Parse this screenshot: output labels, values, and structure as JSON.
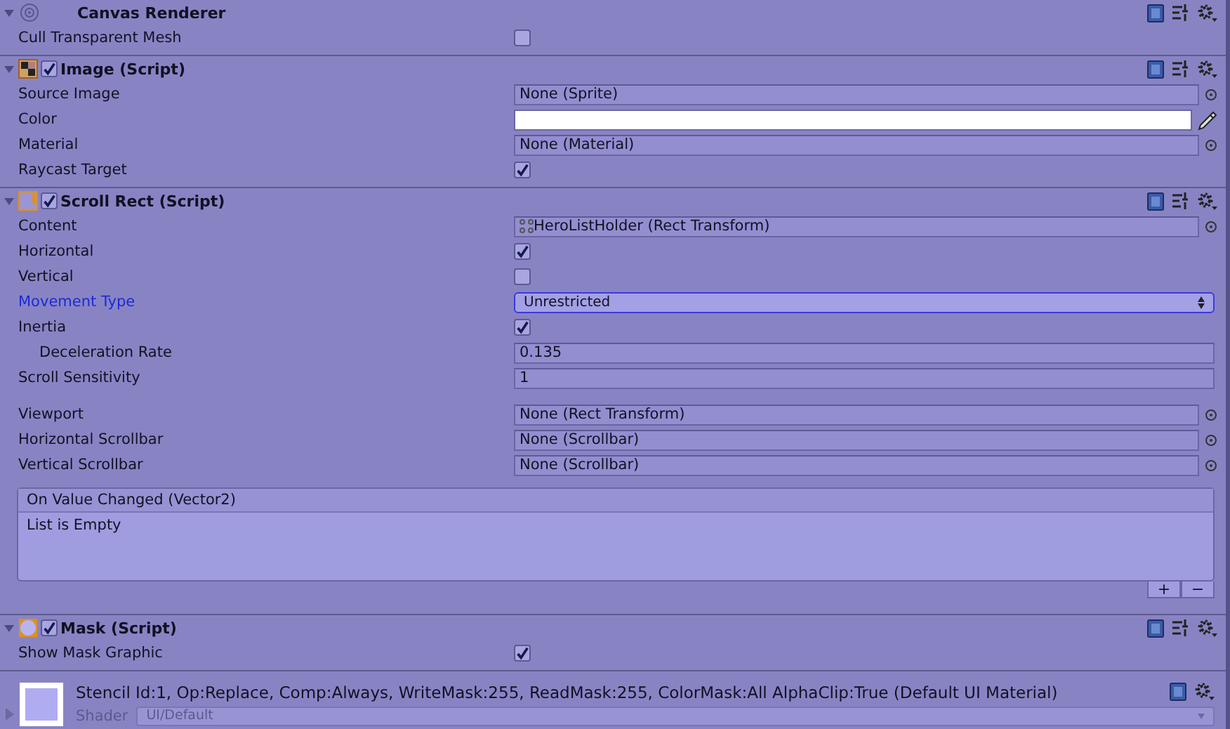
{
  "components": [
    {
      "kind": "canvas_renderer",
      "title": "Canvas Renderer",
      "expanded": true,
      "rows": [
        {
          "kind": "check",
          "label": "Cull Transparent Mesh",
          "checked": false,
          "focused": false
        }
      ]
    },
    {
      "kind": "image",
      "title": "Image (Script)",
      "expanded": true,
      "enabled": true,
      "rows": [
        {
          "kind": "object",
          "label": "Source Image",
          "value": "None (Sprite)",
          "focused": false
        },
        {
          "kind": "color",
          "label": "Color",
          "color": "#ffffff",
          "focused": false
        },
        {
          "kind": "object",
          "label": "Material",
          "value": "None (Material)",
          "focused": false
        },
        {
          "kind": "check",
          "label": "Raycast Target",
          "checked": true,
          "focused": false
        }
      ]
    },
    {
      "kind": "scroll_rect",
      "title": "Scroll Rect (Script)",
      "expanded": true,
      "enabled": true,
      "rows": [
        {
          "kind": "object",
          "label": "Content",
          "value": "HeroListHolder (Rect Transform)",
          "transform": true,
          "focused": false
        },
        {
          "kind": "check",
          "label": "Horizontal",
          "checked": true,
          "focused": false
        },
        {
          "kind": "check",
          "label": "Vertical",
          "checked": false,
          "focused": false
        },
        {
          "kind": "dropdown",
          "label": "Movement Type",
          "value": "Unrestricted",
          "focused": true
        },
        {
          "kind": "check",
          "label": "Inertia",
          "checked": true,
          "focused": false,
          "children": [
            {
              "kind": "number",
              "label": "Deceleration Rate",
              "value": "0.135",
              "focused": false
            }
          ]
        },
        {
          "kind": "number",
          "label": "Scroll Sensitivity",
          "value": "1",
          "focused": false
        }
      ],
      "more_rows": [
        {
          "kind": "object",
          "label": "Viewport",
          "value": "None (Rect Transform)",
          "focused": false
        },
        {
          "kind": "object",
          "label": "Horizontal Scrollbar",
          "value": "None (Scrollbar)",
          "focused": false
        },
        {
          "kind": "object",
          "label": "Vertical Scrollbar",
          "value": "None (Scrollbar)",
          "focused": false
        }
      ],
      "event": {
        "title": "On Value Changed (Vector2)",
        "body": "List is Empty",
        "add": "+",
        "remove": "−"
      }
    },
    {
      "kind": "mask",
      "title": "Mask (Script)",
      "expanded": true,
      "enabled": true,
      "rows": [
        {
          "kind": "check",
          "label": "Show Mask Graphic",
          "checked": true,
          "focused": false
        }
      ]
    }
  ],
  "material": {
    "description": "Stencil Id:1, Op:Replace, Comp:Always, WriteMask:255, ReadMask:255, ColorMask:All AlphaClip:True (Default UI Material)",
    "shader_label": "Shader",
    "shader": "UI/Default",
    "expanded": false
  }
}
